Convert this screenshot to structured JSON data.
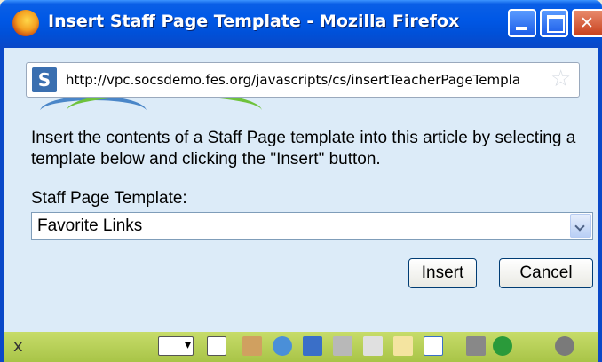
{
  "window": {
    "title": "Insert Staff Page Template - Mozilla Firefox"
  },
  "urlbar": {
    "site_icon_letter": "S",
    "url": "http://vpc.socsdemo.fes.org/javascripts/cs/insertTeacherPageTempla"
  },
  "dialog": {
    "instructions": "Insert the contents of a Staff Page template into this article by selecting a template below and clicking the \"Insert\" button.",
    "field_label": "Staff Page Template:",
    "selected_template": "Favorite Links",
    "insert_label": "Insert",
    "cancel_label": "Cancel"
  },
  "toolbar": {
    "close_glyph": "x",
    "icons": [
      "pen-tool-icon",
      "blank-page-icon",
      "pencil-icon",
      "globe-icon",
      "save-icon",
      "print-icon",
      "eraser-icon",
      "note-icon",
      "chart-icon",
      "tools-icon",
      "help-icon",
      "bug-icon"
    ]
  }
}
